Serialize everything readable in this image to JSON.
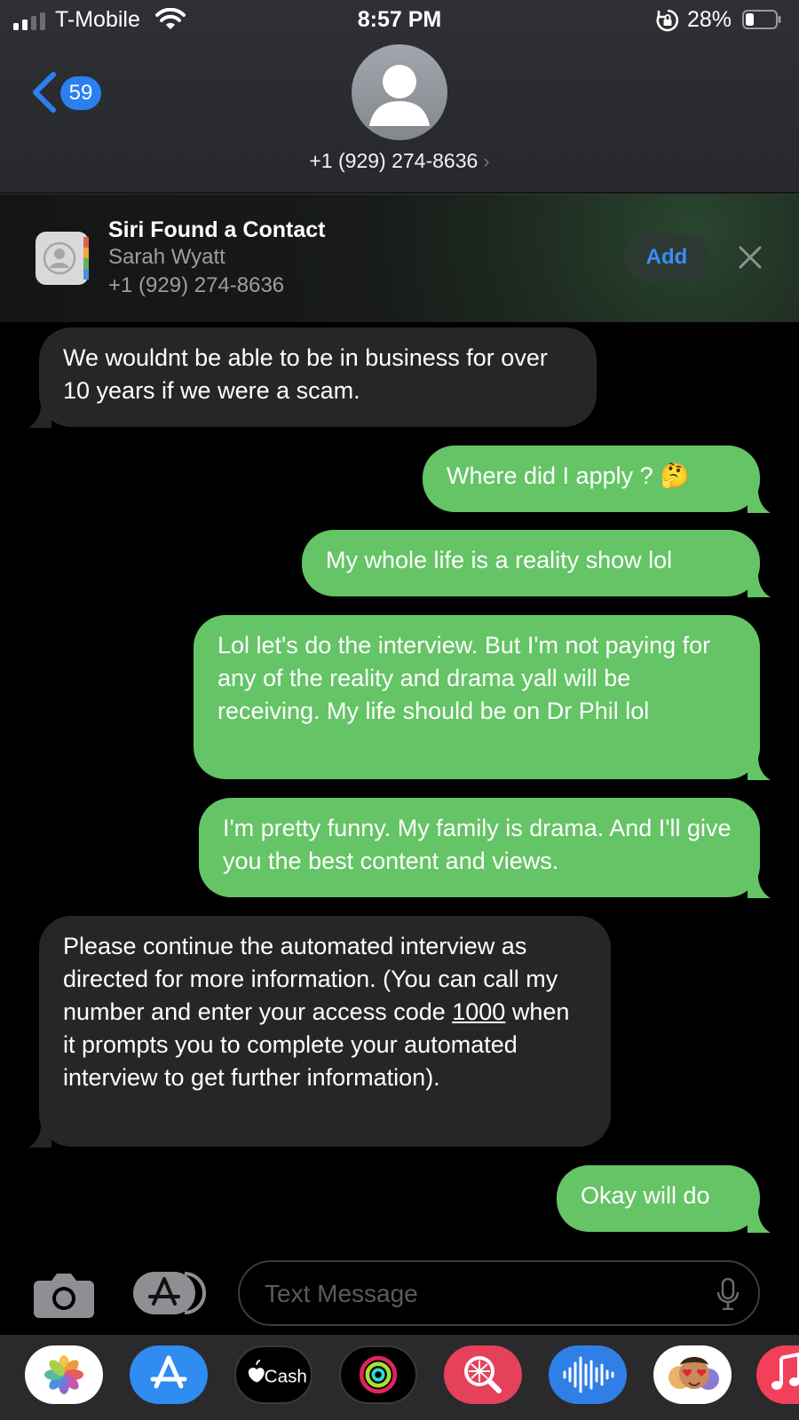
{
  "status_bar": {
    "carrier": "T-Mobile",
    "time": "8:57 PM",
    "battery_percent": "28%",
    "battery_level": 0.28,
    "icons": [
      "signal-icon",
      "wifi-icon",
      "rotation-lock-icon",
      "battery-icon"
    ]
  },
  "header": {
    "back_count": "59",
    "phone": "+1 (929) 274-8636",
    "chevron": "›"
  },
  "siri_banner": {
    "title": "Siri Found a Contact",
    "name": "Sarah Wyatt",
    "phone": "+1 (929) 274-8636",
    "add_label": "Add"
  },
  "messages": [
    {
      "direction": "incoming",
      "text": "We wouldnt be able to be in business for over 10 years if we were a scam."
    },
    {
      "direction": "outgoing",
      "text": "Where did I apply ? 🤔"
    },
    {
      "direction": "outgoing",
      "text": "My whole life is a reality show lol"
    },
    {
      "direction": "outgoing",
      "text": "Lol let's do the interview. But I'm not paying for any of the reality and drama yall will be receiving. My life should be on Dr Phil lol"
    },
    {
      "direction": "outgoing",
      "text": "I'm pretty funny. My family is drama. And I'll give you the best content and views."
    },
    {
      "direction": "incoming",
      "text_before": "Please continue the automated interview as directed for more information. (You can call my number and enter your access code ",
      "link": "1000",
      "text_after": " when it prompts you to complete your automated interview to get further information)."
    },
    {
      "direction": "outgoing",
      "text": "Okay will do"
    }
  ],
  "input": {
    "placeholder": "Text Message"
  },
  "app_drawer": {
    "apps": [
      {
        "name": "Photos",
        "icon": "photos-icon"
      },
      {
        "name": "App Store",
        "icon": "app-store-icon"
      },
      {
        "name": "Cash",
        "label": "Cash",
        "icon": "apple-cash-icon"
      },
      {
        "name": "Activity",
        "icon": "activity-rings-icon"
      },
      {
        "name": "Search",
        "icon": "images-search-icon"
      },
      {
        "name": "Audio",
        "icon": "audio-message-icon"
      },
      {
        "name": "Memoji",
        "icon": "memoji-icon"
      },
      {
        "name": "Music",
        "icon": "music-icon"
      }
    ]
  },
  "colors": {
    "outgoing_bubble": "#65c466",
    "incoming_bubble": "#262629",
    "accent_blue": "#2b7ff0",
    "background": "#000000"
  }
}
